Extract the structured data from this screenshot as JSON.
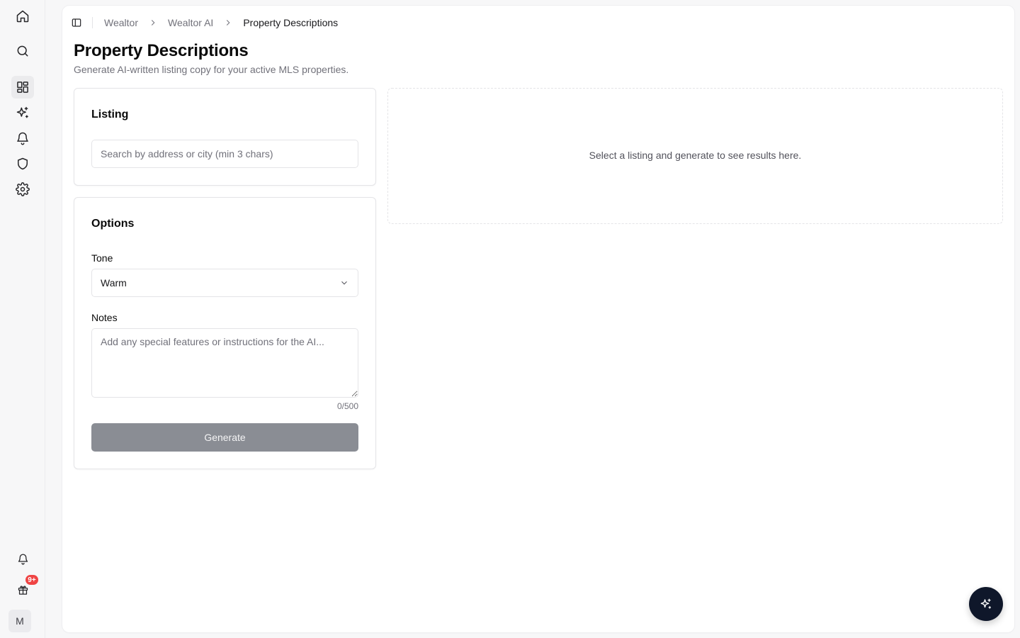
{
  "nav": {
    "items": [
      {
        "icon": "home-icon"
      },
      {
        "icon": "search-icon"
      },
      {
        "icon": "dashboard-icon",
        "active": true
      },
      {
        "icon": "sparkles-icon"
      },
      {
        "icon": "bell-icon"
      },
      {
        "icon": "shield-icon"
      },
      {
        "icon": "gear-icon"
      }
    ],
    "bottom": {
      "notifications_icon": "bell-icon",
      "gifts_icon": "gift-icon",
      "gifts_badge": "9+",
      "avatar_initial": "M"
    }
  },
  "breadcrumb": [
    "Wealtor",
    "Wealtor AI",
    "Property Descriptions"
  ],
  "page": {
    "title": "Property Descriptions",
    "subtitle": "Generate AI-written listing copy for your active MLS properties."
  },
  "listing_card": {
    "title": "Listing",
    "search_placeholder": "Search by address or city (min 3 chars)",
    "search_value": ""
  },
  "options_card": {
    "title": "Options",
    "tone_label": "Tone",
    "tone_value": "Warm",
    "notes_label": "Notes",
    "notes_placeholder": "Add any special features or instructions for the AI...",
    "notes_value": "",
    "counter": "0/500",
    "generate_label": "Generate"
  },
  "results": {
    "empty_text": "Select a listing and generate to see results here."
  },
  "colors": {
    "accent_dark": "#0f172a",
    "badge_red": "#ef4444",
    "disabled_button": "#8a8d94"
  }
}
